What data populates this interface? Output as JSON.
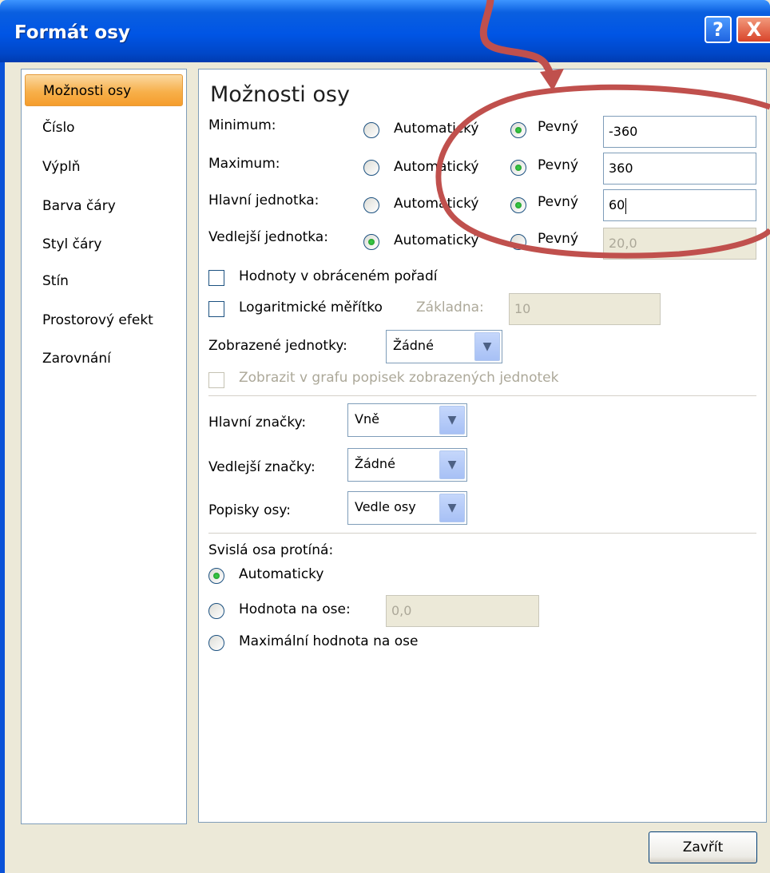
{
  "window": {
    "title": "Formát osy",
    "help_label": "?",
    "close_label": "X"
  },
  "nav": {
    "items": [
      {
        "label": "Možnosti osy"
      },
      {
        "label": "Číslo"
      },
      {
        "label": "Výplň"
      },
      {
        "label": "Barva čáry"
      },
      {
        "label": "Styl čáry"
      },
      {
        "label": "Stín"
      },
      {
        "label": "Prostorový efekt"
      },
      {
        "label": "Zarovnání"
      }
    ]
  },
  "panel": {
    "heading": "Možnosti osy",
    "rows": [
      {
        "label": "Minimum:",
        "auto_label": "Automatický",
        "fixed_label": "Pevný",
        "value": "-360"
      },
      {
        "label": "Maximum:",
        "auto_label": "Automatický",
        "fixed_label": "Pevný",
        "value": "360"
      },
      {
        "label": "Hlavní jednotka:",
        "auto_label": "Automatický",
        "fixed_label": "Pevný",
        "value": "60"
      },
      {
        "label": "Vedlejší jednotka:",
        "auto_label": "Automatický",
        "fixed_label": "Pevný",
        "value": "20,0"
      }
    ],
    "reverse_order_label": "Hodnoty v obráceném pořadí",
    "log_scale_label": "Logaritmické měřítko",
    "base_label": "Základna:",
    "base_value": "10",
    "display_units_label": "Zobrazené jednotky:",
    "display_units_value": "Žádné",
    "show_units_label": "Zobrazit v grafu popisek zobrazených jednotek",
    "major_tick_label": "Hlavní značky:",
    "major_tick_value": "Vně",
    "minor_tick_label": "Vedlejší značky:",
    "minor_tick_value": "Žádné",
    "axis_labels_label": "Popisky osy:",
    "axis_labels_value": "Vedle osy",
    "crosses_title": "Svislá osa protíná:",
    "crosses_auto": "Automaticky",
    "crosses_value_label": "Hodnota na ose:",
    "crosses_value": "0,0",
    "crosses_max": "Maximální hodnota na ose"
  },
  "footer": {
    "close_button": "Zavřít"
  },
  "colors": {
    "annotation": "#c0504d",
    "selected_nav": "#f7b04b",
    "titlebar": "#0055e5"
  }
}
